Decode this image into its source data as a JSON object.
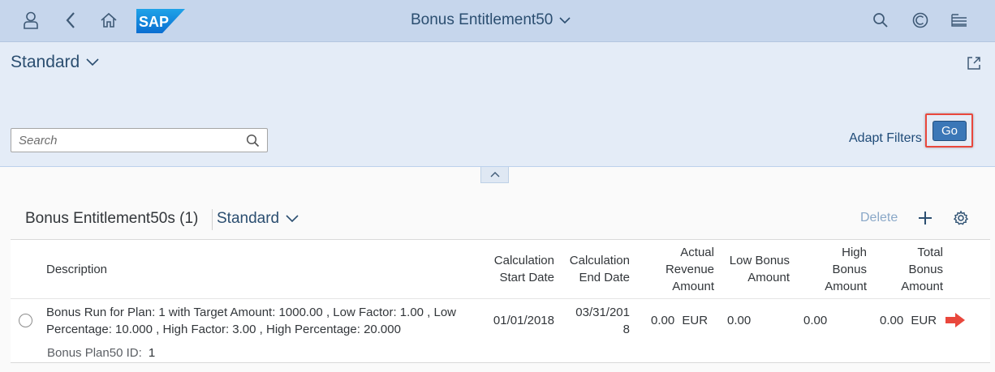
{
  "shell": {
    "title": "Bonus Entitlement50",
    "logo_text": "SAP",
    "icons": [
      "user-icon",
      "back-icon",
      "home-icon",
      "search-icon",
      "copilot-icon",
      "notifications-icon"
    ]
  },
  "header": {
    "variant_label": "Standard",
    "search_placeholder": "Search",
    "search_value": "",
    "adapt_filters_label": "Adapt Filters",
    "go_label": "Go"
  },
  "toolbar": {
    "title": "Bonus Entitlement50s (1)",
    "variant_label": "Standard",
    "delete_label": "Delete"
  },
  "table": {
    "columns": {
      "description": "Description",
      "start_1": "Calculation",
      "start_2": "Start Date",
      "end_1": "Calculation",
      "end_2": "End Date",
      "rev_1": "Actual",
      "rev_2": "Revenue",
      "rev_3": "Amount",
      "low_1": "Low Bonus",
      "low_2": "Amount",
      "high_1": "High",
      "high_2": "Bonus",
      "high_3": "Amount",
      "total_1": "Total",
      "total_2": "Bonus",
      "total_3": "Amount"
    },
    "rows": [
      {
        "desc_line1": "Bonus Run for Plan: 1 with Target Amount: 1000.00 , Low Factor: 1.00 , Low",
        "desc_line2": "Percentage: 10.000 , High Factor: 3.00 , High Percentage: 20.000",
        "plan_label": "Bonus Plan50 ID:",
        "plan_value": "1",
        "start_date": "01/01/2018",
        "end_date_1": "03/31/201",
        "end_date_2": "8",
        "revenue": "0.00",
        "revenue_currency": "EUR",
        "low_amount": "0.00",
        "high_amount": "0.00",
        "total_amount": "0.00",
        "total_currency": "EUR"
      }
    ]
  },
  "colors": {
    "shell_bg": "#c6d6ec",
    "header_bg": "#e4ecf7",
    "accent": "#3b77b7",
    "highlight_frame": "#e9473c",
    "annotation_arrow": "#e9473c"
  }
}
